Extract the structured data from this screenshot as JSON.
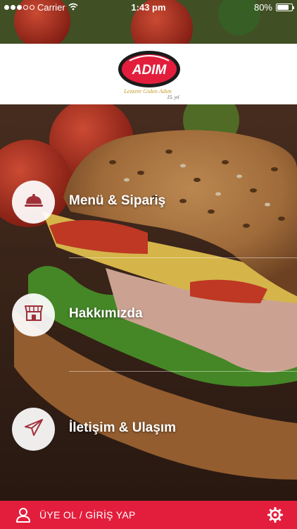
{
  "status_bar": {
    "carrier": "Carrier",
    "time": "1:43 pm",
    "battery": "80%",
    "battery_level": 0.8,
    "signal_icon": "signal-dots-icon",
    "wifi_icon": "wifi-icon"
  },
  "header": {
    "logo_text": "ADIM",
    "logo_tagline": "Lezzete Giden Adım",
    "logo_year": "15. yıl"
  },
  "menu": {
    "items": [
      {
        "label": "Menü & Sipariş",
        "icon": "food-cloche-icon"
      },
      {
        "label": "Hakkımızda",
        "icon": "storefront-icon"
      },
      {
        "label": "İletişim & Ulaşım",
        "icon": "paper-plane-icon"
      }
    ]
  },
  "bottom_bar": {
    "label": "ÜYE OL / GİRİŞ YAP",
    "user_icon": "user-icon",
    "settings_icon": "gear-icon"
  },
  "colors": {
    "accent": "#e31e3d",
    "menu_icon": "#a0303a",
    "header_bg": "#ffffff"
  }
}
